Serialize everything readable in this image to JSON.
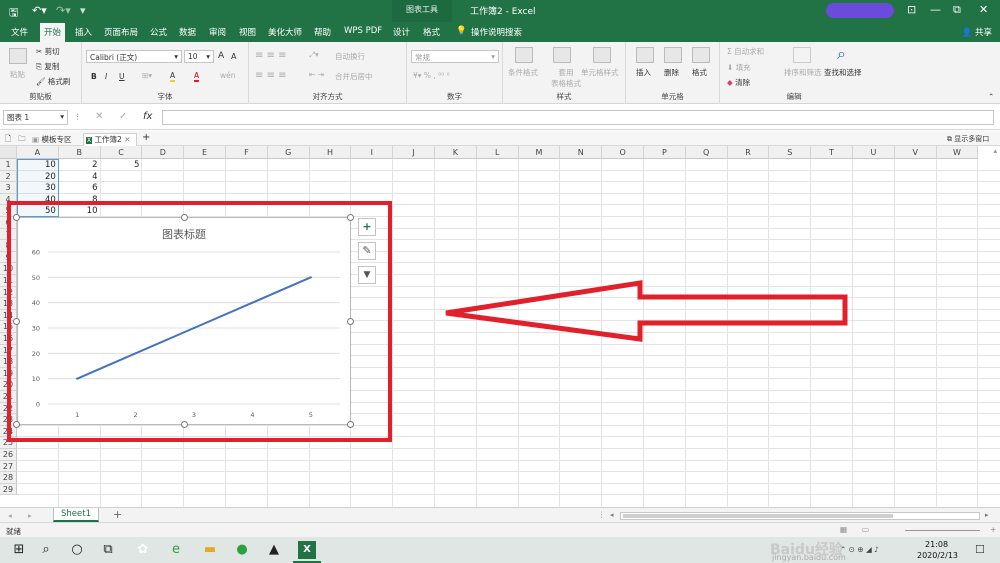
{
  "titlebar": {
    "save_icon": "save-icon",
    "undo_icon": "undo-icon",
    "redo_icon": "redo-icon",
    "chart_tools": "图表工具",
    "title": "工作簿2  -  Excel",
    "minimize": "—",
    "maximize": "▭",
    "close": "✕",
    "restore": "⧉"
  },
  "tabs": [
    {
      "label": "文件"
    },
    {
      "label": "开始"
    },
    {
      "label": "插入"
    },
    {
      "label": "页面布局"
    },
    {
      "label": "公式"
    },
    {
      "label": "数据"
    },
    {
      "label": "审阅"
    },
    {
      "label": "视图"
    },
    {
      "label": "美化大师"
    },
    {
      "label": "帮助"
    },
    {
      "label": "WPS PDF"
    },
    {
      "label": "设计"
    },
    {
      "label": "格式"
    }
  ],
  "search_hint": "操作说明搜索",
  "share": "共享",
  "ribbon": {
    "clipboard": {
      "paste": "粘贴",
      "cut": "剪切",
      "copy": "复制",
      "format_painter": "格式刷",
      "label": "剪贴板"
    },
    "font": {
      "name": "Calibri (正文)",
      "size": "10",
      "label": "字体",
      "bold": "B",
      "italic": "I",
      "underline": "U",
      "grow": "A",
      "shrink": "A",
      "fill": "A",
      "color": "A",
      "wen": "wén"
    },
    "align": {
      "wrap": "自动换行",
      "merge": "合并后居中",
      "label": "对齐方式"
    },
    "number": {
      "format": "常规",
      "label": "数字"
    },
    "styles": {
      "cond": "条件格式",
      "table": "套用\n表格格式",
      "cell": "单元格样式",
      "label": "样式"
    },
    "cells": {
      "insert": "插入",
      "delete": "删除",
      "format": "格式",
      "label": "单元格"
    },
    "edit": {
      "autosum": "自动求和",
      "fill": "填充",
      "clear": "清除",
      "sort": "排序和筛选",
      "find": "查找和选择",
      "label": "编辑"
    }
  },
  "formula_bar": {
    "name_box": "图表 1",
    "fx": "fx",
    "value": ""
  },
  "workbook_tabs": [
    {
      "label": "模板专区"
    },
    {
      "label": "工作簿2"
    }
  ],
  "workbook_add": "+",
  "show_multi": "显示多窗口",
  "columns": [
    "A",
    "B",
    "C",
    "D",
    "E",
    "F",
    "G",
    "H",
    "I",
    "J",
    "K",
    "L",
    "M",
    "N",
    "O",
    "P",
    "Q",
    "R",
    "S",
    "T",
    "U",
    "V",
    "W"
  ],
  "rows": [
    "1",
    "2",
    "3",
    "4",
    "5",
    "6",
    "7",
    "8",
    "9",
    "10",
    "11",
    "12",
    "13",
    "14",
    "15",
    "16",
    "17",
    "18",
    "19",
    "20",
    "21",
    "22",
    "23",
    "24",
    "25",
    "26",
    "27",
    "28",
    "29"
  ],
  "cells": [
    {
      "ref": "A1",
      "value": "10"
    },
    {
      "ref": "B1",
      "value": "2"
    },
    {
      "ref": "C1",
      "value": "5"
    },
    {
      "ref": "A2",
      "value": "20"
    },
    {
      "ref": "B2",
      "value": "4"
    },
    {
      "ref": "A3",
      "value": "30"
    },
    {
      "ref": "B3",
      "value": "6"
    },
    {
      "ref": "A4",
      "value": "40"
    },
    {
      "ref": "B4",
      "value": "8"
    },
    {
      "ref": "A5",
      "value": "50"
    },
    {
      "ref": "B5",
      "value": "10"
    }
  ],
  "chart_data": {
    "type": "line",
    "title": "图表标题",
    "x": [
      "1",
      "2",
      "3",
      "4",
      "5"
    ],
    "series": [
      {
        "values": [
          10,
          20,
          30,
          40,
          50
        ],
        "color": "#4472c4"
      }
    ],
    "yticks": [
      "0",
      "10",
      "20",
      "30",
      "40",
      "50",
      "60"
    ],
    "ylim": [
      0,
      60
    ],
    "grid": true,
    "legend": "none"
  },
  "chart_buttons": {
    "elements": "+",
    "styles": "✎",
    "filter": "▼"
  },
  "sheet_tabs": [
    {
      "label": "Sheet1"
    }
  ],
  "sheet_add": "+",
  "status": "就绪",
  "taskbar": {
    "time": "21:08",
    "date": "2020/2/13",
    "watermark1": "Baidu经验",
    "watermark2": "jingyan.baidu.com"
  },
  "colors": {
    "excel_green": "#217346",
    "annotation_red": "#e2202c",
    "series_blue": "#4472c4"
  }
}
